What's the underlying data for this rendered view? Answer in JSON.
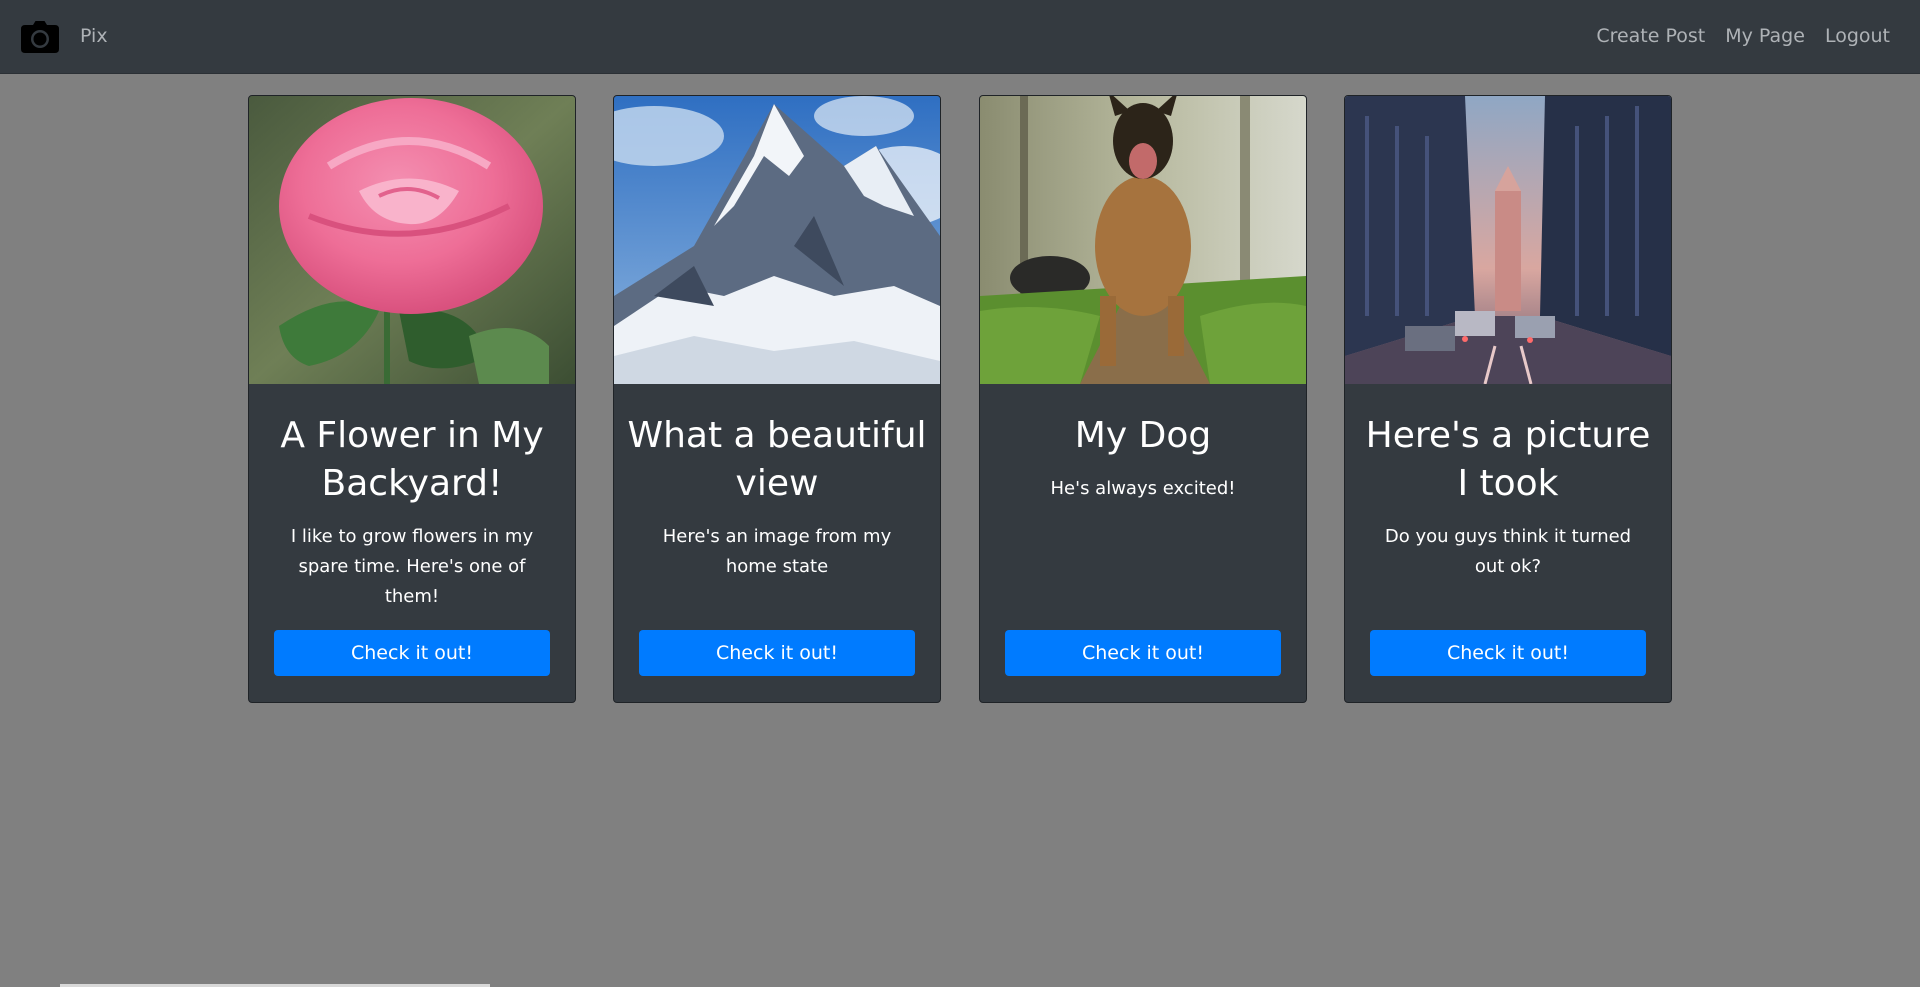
{
  "navbar": {
    "brand": "Pix",
    "brand_icon": "camera-icon",
    "links": [
      "Create Post",
      "My Page",
      "Logout"
    ]
  },
  "posts": [
    {
      "title": "A Flower in My Backyard!",
      "text": "I like to grow flowers in my spare time. Here's one of them!",
      "image": "pink rose photo",
      "button": "Check it out!"
    },
    {
      "title": "What a beautiful view",
      "text": "Here's an image from my home state",
      "image": "snowy mountain photo",
      "button": "Check it out!"
    },
    {
      "title": "My Dog",
      "text": "He's always excited!",
      "image": "running dog photo",
      "button": "Check it out!"
    },
    {
      "title": "Here's a picture I took",
      "text": "Do you guys think it turned out ok?",
      "image": "city street photo",
      "button": "Check it out!"
    }
  ],
  "colors": {
    "page_background": "#808080",
    "navbar_background": "#343a40",
    "card_background": "#343a40",
    "button": "#007bff",
    "nav_text": "#aeb2b6"
  }
}
